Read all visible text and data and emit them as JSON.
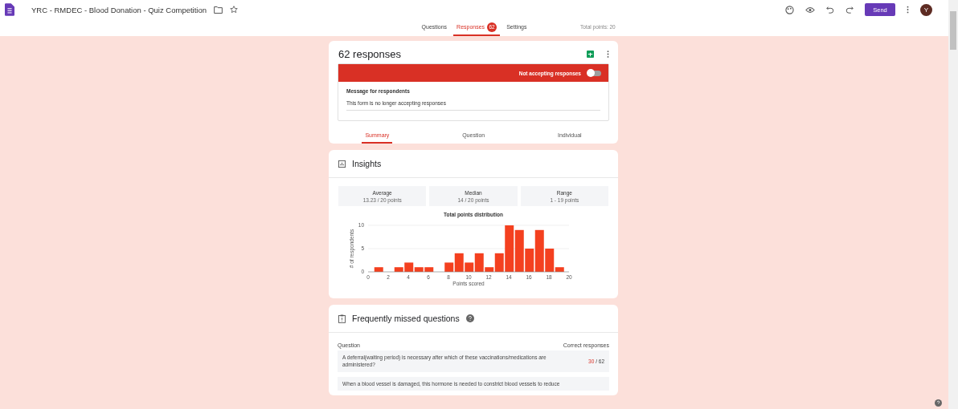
{
  "header": {
    "title": "YRC - RMDEC - Blood Donation - Quiz Competition",
    "send_label": "Send",
    "avatar_letter": "Y"
  },
  "tabs": [
    {
      "label": "Questions",
      "selected": false
    },
    {
      "label": "Responses",
      "selected": true,
      "badge": "62"
    },
    {
      "label": "Settings",
      "selected": false
    }
  ],
  "total_points": "Total points: 20",
  "responses_card": {
    "title": "62 responses",
    "accepting_label": "Not accepting responses",
    "accepting": false,
    "message_label": "Message for respondents",
    "message": "This form is no longer accepting responses",
    "views": [
      {
        "label": "Summary",
        "selected": true
      },
      {
        "label": "Question",
        "selected": false
      },
      {
        "label": "Individual",
        "selected": false
      }
    ]
  },
  "insights": {
    "title": "Insights",
    "stats": [
      {
        "label": "Average",
        "value": "13.23 / 20 points"
      },
      {
        "label": "Median",
        "value": "14 / 20 points"
      },
      {
        "label": "Range",
        "value": "1 - 19 points"
      }
    ],
    "chart_data": {
      "type": "bar",
      "title": "Total points distribution",
      "xlabel": "Points scored",
      "ylabel": "# of respondents",
      "x": [
        1,
        2,
        3,
        4,
        5,
        6,
        7,
        8,
        9,
        10,
        11,
        12,
        13,
        14,
        15,
        16,
        17,
        18,
        19
      ],
      "series": [
        {
          "color": "#f4401f",
          "values": [
            1,
            0,
            1,
            2,
            1,
            1,
            0,
            2,
            4,
            2,
            4,
            1,
            4,
            10,
            9,
            5,
            9,
            5,
            1
          ]
        }
      ],
      "xlim": [
        0,
        20
      ],
      "ylim": [
        0,
        10
      ],
      "xticks": [
        0,
        2,
        4,
        6,
        8,
        10,
        12,
        14,
        16,
        18,
        20
      ],
      "yticks": [
        0,
        5,
        10
      ]
    }
  },
  "missed": {
    "title": "Frequently missed questions",
    "col_question": "Question",
    "col_correct": "Correct responses",
    "rows": [
      {
        "question": "A deferral(waiting period) is necessary after which of these vaccinations/medications are administered?",
        "correct": "30",
        "total": "/ 62"
      },
      {
        "question": "When a blood vessel is damaged, this hormone is needed to constrict blood vessels to reduce"
      }
    ]
  }
}
